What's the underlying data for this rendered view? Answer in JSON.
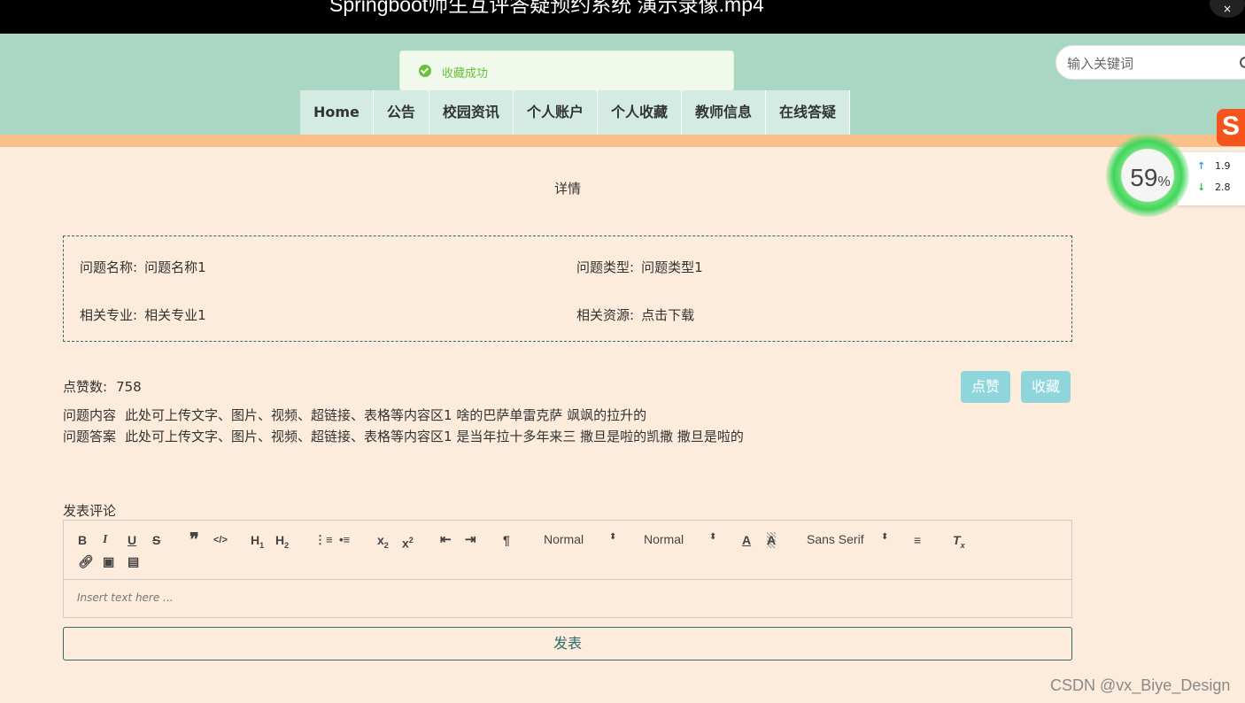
{
  "video_bar": {
    "title": "Springboot师生互评答疑预约系统 演示录像.mp4",
    "close_label": "×"
  },
  "toast": {
    "message": "收藏成功"
  },
  "nav": {
    "items": [
      "Home",
      "公告",
      "校园资讯",
      "个人账户",
      "个人收藏",
      "教师信息",
      "在线答疑"
    ]
  },
  "search": {
    "placeholder": "输入关键词"
  },
  "overlay": {
    "sogou_logo": "S",
    "gauge_value": "59",
    "gauge_unit": "%",
    "upload_speed": "1.9",
    "download_speed": "2.8"
  },
  "page": {
    "title": "详情"
  },
  "info": {
    "name_label": "问题名称:",
    "name_value": "问题名称1",
    "type_label": "问题类型:",
    "type_value": "问题类型1",
    "major_label": "相关专业:",
    "major_value": "相关专业1",
    "resource_label": "相关资源:",
    "resource_value": "点击下载"
  },
  "stats": {
    "likes_label": "点赞数:",
    "likes_value": "758"
  },
  "buttons": {
    "like": "点赞",
    "favorite": "收藏"
  },
  "content": {
    "question_label": "问题内容",
    "question_text": "此处可上传文字、图片、视频、超链接、表格等内容区1 啥的巴萨单雷克萨 飒飒的拉升的",
    "answer_label": "问题答案",
    "answer_text": "此处可上传文字、图片、视频、超链接、表格等内容区1 是当年拉十多年来三 撒旦是啦的凯撒 撒旦是啦的"
  },
  "comment": {
    "label": "发表评论",
    "placeholder": "Insert text here ...",
    "submit": "发表",
    "toolbar": {
      "header_select": "Normal",
      "size_select": "Normal",
      "font_select": "Sans Serif"
    }
  },
  "watermark": "CSDN @vx_Biye_Design",
  "colors": {
    "header_bg": "#aad7c4",
    "nav_bg": "#d3ebe2",
    "page_bg": "#fdebdc",
    "accent_strip": "#fbc089",
    "button_bg": "#8fd6dc",
    "border_teal": "#2e6b6b",
    "toast_green": "#67c23a"
  }
}
